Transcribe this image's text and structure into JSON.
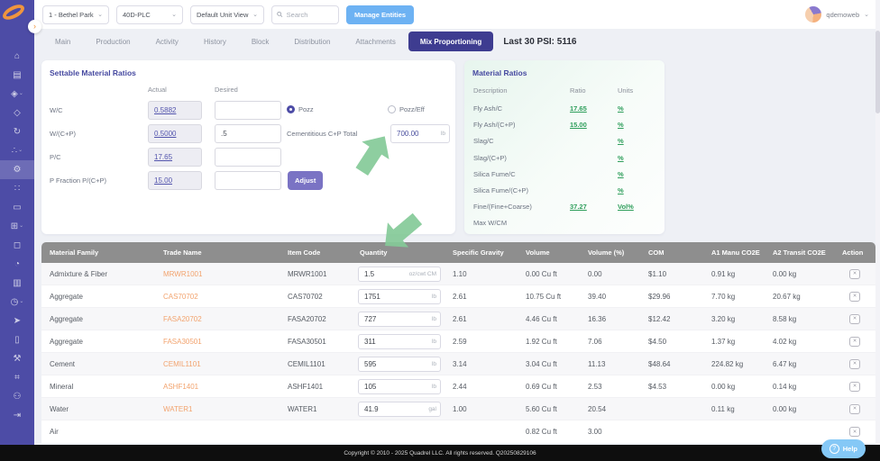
{
  "colors": {
    "sidebar": "#4d4ca6",
    "active_tab": "#3e3c90",
    "primary_button": "#6db2f3",
    "logo_orange": "#f0953e",
    "green_link": "#2e9e5b",
    "trade_link": "#f2a36e",
    "arrow_green": "#85ca98",
    "table_header": "#8e8e8e",
    "help_blue": "#85c8f6"
  },
  "icons": {
    "chevron_down": "⌄",
    "chevron_right": "›",
    "remove_x": "✕",
    "help_q": "?"
  },
  "sidebar": {
    "items": [
      {
        "name": "home",
        "glyph": "⌂"
      },
      {
        "name": "document",
        "glyph": "▤"
      },
      {
        "name": "materials",
        "glyph": "◈"
      },
      {
        "name": "layers",
        "glyph": "◇"
      },
      {
        "name": "cycle",
        "glyph": "↻"
      },
      {
        "name": "network",
        "glyph": "∴"
      },
      {
        "name": "mix-design",
        "glyph": "⚙"
      },
      {
        "name": "nodes",
        "glyph": "∷"
      },
      {
        "name": "folder",
        "glyph": "▭"
      },
      {
        "name": "calculator",
        "glyph": "⊞"
      },
      {
        "name": "box",
        "glyph": "◻"
      },
      {
        "name": "notifications",
        "glyph": "◔"
      },
      {
        "name": "analytics",
        "glyph": "▥"
      },
      {
        "name": "history",
        "glyph": "◷"
      },
      {
        "name": "send",
        "glyph": "➤"
      },
      {
        "name": "badge",
        "glyph": "▯"
      },
      {
        "name": "tools",
        "glyph": "⚒"
      },
      {
        "name": "settings",
        "glyph": "⌗"
      },
      {
        "name": "user",
        "glyph": "⚇"
      },
      {
        "name": "sign-out",
        "glyph": "⇥"
      }
    ]
  },
  "topbar": {
    "plant": "1 - Bethel Park",
    "device": "40D-PLC",
    "unit_view": "Default Unit View",
    "search_placeholder": "Search",
    "manage_entities": "Manage Entities"
  },
  "user": {
    "name": "qdemoweb"
  },
  "tabs": {
    "items": [
      "Main",
      "Production",
      "Activity",
      "History",
      "Block",
      "Distribution",
      "Attachments",
      "Mix Proportioning"
    ],
    "last30": "Last 30 PSI: 5116"
  },
  "settable": {
    "title": "Settable Material Ratios",
    "col_actual": "Actual",
    "col_desired": "Desired",
    "rows": [
      {
        "label": "W/C",
        "actual": "0.5882",
        "desired": ""
      },
      {
        "label": "W/(C+P)",
        "actual": "0.5000",
        "desired": ".5"
      },
      {
        "label": "P/C",
        "actual": "17.65",
        "desired": ""
      },
      {
        "label": "P Fraction P/(C+P)",
        "actual": "15.00",
        "desired": ""
      }
    ],
    "pozz_label": "Pozz",
    "pozzeff_label": "Pozz/Eff",
    "cementitious_label": "Cementitious C+P Total",
    "cementitious_value": "700.00",
    "cementitious_unit": "lb",
    "adjust_label": "Adjust"
  },
  "material_ratios": {
    "title": "Material Ratios",
    "col_description": "Description",
    "col_ratio": "Ratio",
    "col_units": "Units",
    "rows": [
      {
        "description": "Fly Ash/C",
        "ratio": "17.65",
        "units": "%"
      },
      {
        "description": "Fly Ash/(C+P)",
        "ratio": "15.00",
        "units": "%"
      },
      {
        "description": "Slag/C",
        "ratio": "",
        "units": "%"
      },
      {
        "description": "Slag/(C+P)",
        "ratio": "",
        "units": "%"
      },
      {
        "description": "Silica Fume/C",
        "ratio": "",
        "units": "%"
      },
      {
        "description": "Silica Fume/(C+P)",
        "ratio": "",
        "units": "%"
      },
      {
        "description": "Fine/(Fine+Coarse)",
        "ratio": "37.27",
        "units": "Vol%"
      },
      {
        "description": "Max W/CM",
        "ratio": "",
        "units": ""
      }
    ]
  },
  "materials_table": {
    "headers": [
      "Material Family",
      "Trade Name",
      "Item Code",
      "Quantity",
      "Specific Gravity",
      "Volume",
      "Volume (%)",
      "COM",
      "A1 Manu CO2E",
      "A2 Transit CO2E",
      "Action"
    ],
    "rows": [
      {
        "family": "Admixture & Fiber",
        "trade": "MRWR1001",
        "code": "MRWR1001",
        "qty": "1.5",
        "qty_unit": "oz/cwt CM",
        "sg": "1.10",
        "volume": "0.00 Cu ft",
        "volume_pct": "0.00",
        "com": "$1.10",
        "a1": "0.91 kg",
        "a2": "0.00 kg"
      },
      {
        "family": "Aggregate",
        "trade": "CAS70702",
        "code": "CAS70702",
        "qty": "1751",
        "qty_unit": "lb",
        "sg": "2.61",
        "volume": "10.75 Cu ft",
        "volume_pct": "39.40",
        "com": "$29.96",
        "a1": "7.70 kg",
        "a2": "20.67 kg"
      },
      {
        "family": "Aggregate",
        "trade": "FASA20702",
        "code": "FASA20702",
        "qty": "727",
        "qty_unit": "lb",
        "sg": "2.61",
        "volume": "4.46 Cu ft",
        "volume_pct": "16.36",
        "com": "$12.42",
        "a1": "3.20 kg",
        "a2": "8.58 kg"
      },
      {
        "family": "Aggregate",
        "trade": "FASA30501",
        "code": "FASA30501",
        "qty": "311",
        "qty_unit": "lb",
        "sg": "2.59",
        "volume": "1.92 Cu ft",
        "volume_pct": "7.06",
        "com": "$4.50",
        "a1": "1.37 kg",
        "a2": "4.02 kg"
      },
      {
        "family": "Cement",
        "trade": "CEMIL1101",
        "code": "CEMIL1101",
        "qty": "595",
        "qty_unit": "lb",
        "sg": "3.14",
        "volume": "3.04 Cu ft",
        "volume_pct": "11.13",
        "com": "$48.64",
        "a1": "224.82 kg",
        "a2": "6.47 kg"
      },
      {
        "family": "Mineral",
        "trade": "ASHF1401",
        "code": "ASHF1401",
        "qty": "105",
        "qty_unit": "lb",
        "sg": "2.44",
        "volume": "0.69 Cu ft",
        "volume_pct": "2.53",
        "com": "$4.53",
        "a1": "0.00 kg",
        "a2": "0.14 kg"
      },
      {
        "family": "Water",
        "trade": "WATER1",
        "code": "WATER1",
        "qty": "41.9",
        "qty_unit": "gal",
        "sg": "1.00",
        "volume": "5.60 Cu ft",
        "volume_pct": "20.54",
        "com": "",
        "a1": "0.11 kg",
        "a2": "0.00 kg"
      },
      {
        "family": "Air",
        "trade": "",
        "code": "",
        "qty": "",
        "qty_unit": "",
        "sg": "",
        "volume": "0.82 Cu ft",
        "volume_pct": "3.00",
        "com": "",
        "a1": "",
        "a2": ""
      }
    ]
  },
  "footer": {
    "copyright": "Copyright © 2010 - 2025 Quadrel LLC. All rights reserved. Q20250829106"
  },
  "help": {
    "label": "Help"
  }
}
